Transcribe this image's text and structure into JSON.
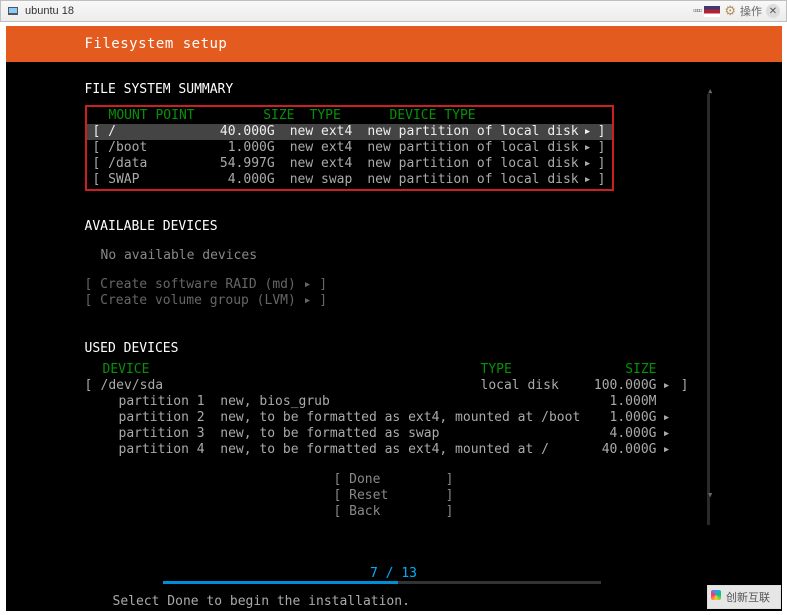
{
  "titlebar": {
    "title": "ubuntu 18",
    "action_label": "操作"
  },
  "header": {
    "title": "Filesystem setup"
  },
  "fs_summary": {
    "title": "FILE SYSTEM SUMMARY",
    "columns": {
      "mount": "MOUNT POINT",
      "size": "SIZE",
      "type": "TYPE",
      "device": "DEVICE TYPE"
    },
    "rows": [
      {
        "mount": "/",
        "size": "40.000G",
        "type": "new ext4",
        "device": "new partition of local disk",
        "selected": true
      },
      {
        "mount": "/boot",
        "size": "1.000G",
        "type": "new ext4",
        "device": "new partition of local disk",
        "selected": false
      },
      {
        "mount": "/data",
        "size": "54.997G",
        "type": "new ext4",
        "device": "new partition of local disk",
        "selected": false
      },
      {
        "mount": "SWAP",
        "size": "4.000G",
        "type": "new swap",
        "device": "new partition of local disk",
        "selected": false
      }
    ]
  },
  "available": {
    "title": "AVAILABLE DEVICES",
    "none_text": "No available devices",
    "raid": "[ Create software RAID (md) ▸ ]",
    "lvm": "[ Create volume group (LVM) ▸ ]"
  },
  "used": {
    "title": "USED DEVICES",
    "columns": {
      "device": "DEVICE",
      "type": "TYPE",
      "size": "SIZE"
    },
    "disk": {
      "device": "/dev/sda",
      "type": "local disk",
      "size": "100.000G"
    },
    "parts": [
      {
        "name": "partition 1",
        "desc": "new, bios_grub",
        "size": "1.000M",
        "arrow": false
      },
      {
        "name": "partition 2",
        "desc": "new, to be formatted as ext4, mounted at /boot",
        "size": "1.000G",
        "arrow": true
      },
      {
        "name": "partition 3",
        "desc": "new, to be formatted as swap",
        "size": "4.000G",
        "arrow": true
      },
      {
        "name": "partition 4",
        "desc": "new, to be formatted as ext4, mounted at /",
        "size": "40.000G",
        "arrow": true
      }
    ]
  },
  "buttons": {
    "done": "Done",
    "reset": "Reset",
    "back": "Back"
  },
  "progress": {
    "current": 7,
    "total": 13,
    "text": "7 / 13",
    "percent": 53.8
  },
  "footer": {
    "hint": "Select Done to begin the installation."
  },
  "watermark": "创新互联"
}
